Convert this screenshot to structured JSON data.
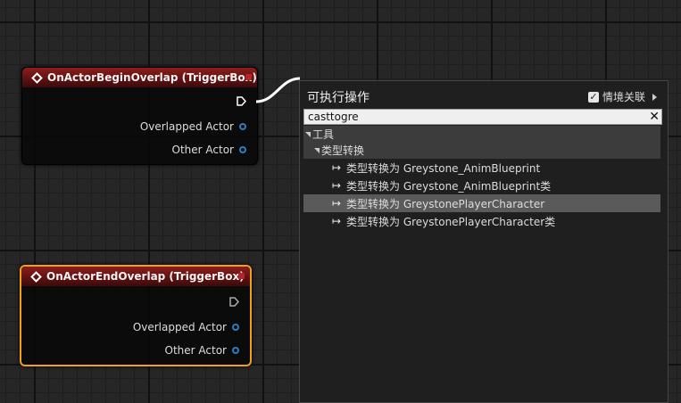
{
  "node1": {
    "title": "OnActorBeginOverlap (TriggerBox)",
    "pins": [
      "Overlapped Actor",
      "Other Actor"
    ]
  },
  "node2": {
    "title": "OnActorEndOverlap (TriggerBox)",
    "pins": [
      "Overlapped Actor",
      "Other Actor"
    ]
  },
  "menu": {
    "title": "可执行操作",
    "context_label": "情境关联",
    "context_checked": true,
    "search_value": "casttogre",
    "categories": [
      "工具",
      "类型转换"
    ],
    "items": [
      "类型转换为 Greystone_AnimBlueprint",
      "类型转换为 Greystone_AnimBlueprint类",
      "类型转换为 GreystonePlayerCharacter",
      "类型转换为 GreystonePlayerCharacter类"
    ],
    "selected_index": 2
  },
  "colors": {
    "node_header": "#8e1d1d",
    "selected_node_border": "#f0a119",
    "pin_blue": "#2b7ec2"
  }
}
